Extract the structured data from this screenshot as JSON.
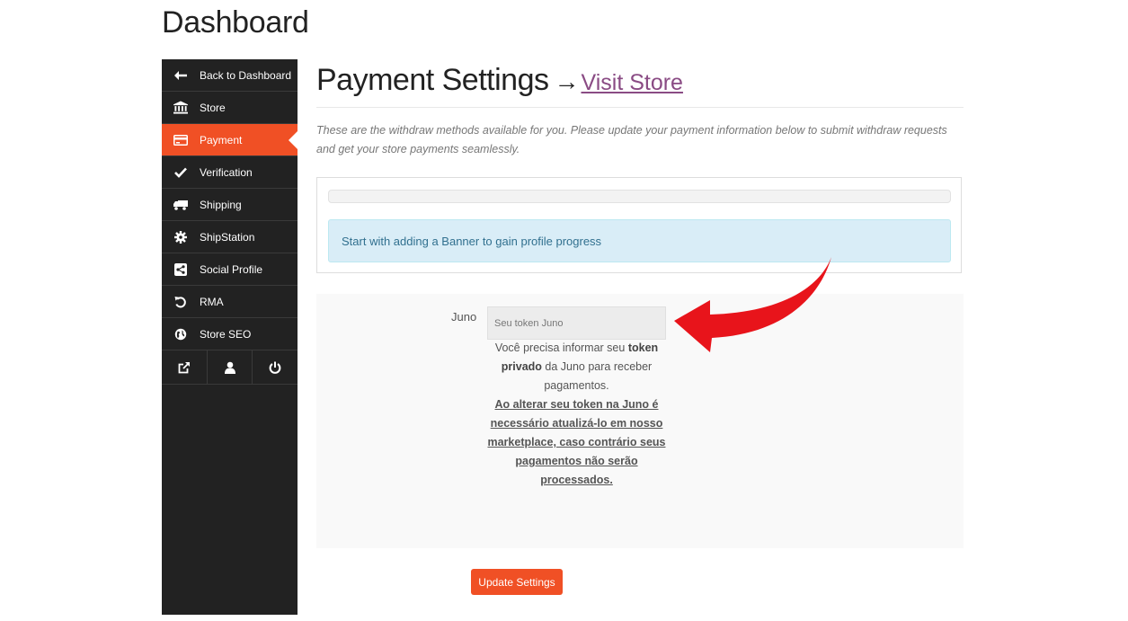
{
  "page": {
    "title": "Dashboard"
  },
  "sidebar": {
    "items": [
      {
        "label": "Back to Dashboard",
        "icon": "arrow-left-icon"
      },
      {
        "label": "Store",
        "icon": "bank-icon"
      },
      {
        "label": "Payment",
        "icon": "credit-card-icon",
        "active": true
      },
      {
        "label": "Verification",
        "icon": "check-icon"
      },
      {
        "label": "Shipping",
        "icon": "truck-icon"
      },
      {
        "label": "ShipStation",
        "icon": "gear-icon"
      },
      {
        "label": "Social Profile",
        "icon": "share-icon"
      },
      {
        "label": "RMA",
        "icon": "undo-icon"
      },
      {
        "label": "Store SEO",
        "icon": "globe-icon"
      }
    ],
    "bottom_icons": [
      "external-link-icon",
      "user-icon",
      "power-icon"
    ]
  },
  "main": {
    "heading": "Payment Settings",
    "arrow": "→",
    "visit_store": "Visit Store",
    "description": "These are the withdraw methods available for you. Please update your payment information below to submit withdraw requests and get your store payments seamlessly.",
    "progress_alert": "Start with adding a Banner to gain profile progress",
    "progress_percent": 0
  },
  "form": {
    "label": "Juno",
    "placeholder": "Seu token Juno",
    "help_pre": "Você precisa informar seu ",
    "help_bold": "token privado",
    "help_post": " da Juno para receber pagamentos.",
    "help_warning": "Ao alterar seu token na Juno é necessário atualizá-lo em nosso marketplace, caso contrário seus pagamentos não serão processados."
  },
  "button": {
    "update": "Update Settings"
  },
  "colors": {
    "accent": "#f05025",
    "sidebar_bg": "#222222",
    "link": "#8a4b84",
    "annotation_arrow": "#e8141b"
  }
}
